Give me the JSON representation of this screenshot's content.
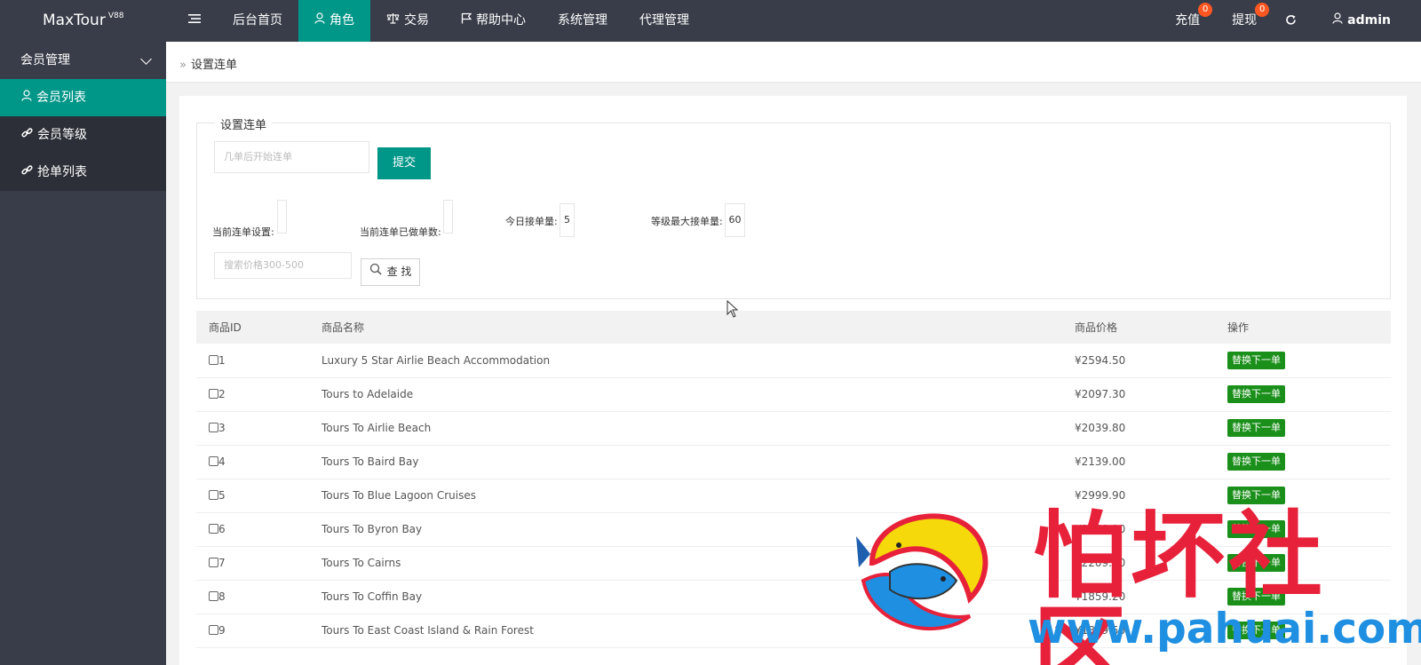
{
  "brand": {
    "name": "MaxTour",
    "version": "V88"
  },
  "topnav": {
    "items": [
      {
        "label": "后台首页",
        "icon": ""
      },
      {
        "label": "角色",
        "icon": "user-icon"
      },
      {
        "label": "交易",
        "icon": "balance-icon"
      },
      {
        "label": "帮助中心",
        "icon": "flag-icon"
      },
      {
        "label": "系统管理",
        "icon": ""
      },
      {
        "label": "代理管理",
        "icon": ""
      }
    ],
    "active_index": 1,
    "recharge": {
      "label": "充值",
      "badge": "0"
    },
    "withdraw": {
      "label": "提现",
      "badge": "0"
    },
    "user": "admin"
  },
  "sidebar": {
    "group": "会员管理",
    "items": [
      {
        "label": "会员列表",
        "icon": "user-icon"
      },
      {
        "label": "会员等级",
        "icon": "link-icon"
      },
      {
        "label": "抢单列表",
        "icon": "link-icon"
      }
    ],
    "active_index": 0
  },
  "breadcrumb": {
    "current": "设置连单"
  },
  "form": {
    "legend": "设置连单",
    "start_placeholder": "几单后开始连单",
    "submit_label": "提交",
    "current_setting_label": "当前连单设置:",
    "current_setting_value": "",
    "current_done_label": "当前连单已做单数:",
    "current_done_value": "",
    "today_label": "今日接单量:",
    "today_value": "5",
    "max_label": "等级最大接单量:",
    "max_value": "60",
    "search_placeholder": "搜索价格300-500",
    "search_label": "查 找"
  },
  "table": {
    "headers": [
      "商品ID",
      "商品名称",
      "商品价格",
      "操作"
    ],
    "action_label": "替换下一单",
    "rows": [
      {
        "id": "1",
        "name": "Luxury 5 Star Airlie Beach Accommodation",
        "price": "¥2594.50"
      },
      {
        "id": "2",
        "name": "Tours to Adelaide",
        "price": "¥2097.30"
      },
      {
        "id": "3",
        "name": "Tours To Airlie Beach",
        "price": "¥2039.80"
      },
      {
        "id": "4",
        "name": "Tours To Baird Bay",
        "price": "¥2139.00"
      },
      {
        "id": "5",
        "name": "Tours To Blue Lagoon Cruises",
        "price": "¥2999.90"
      },
      {
        "id": "6",
        "name": "Tours To Byron Bay",
        "price": "¥2789.90"
      },
      {
        "id": "7",
        "name": "Tours To Cairns",
        "price": "¥2209.50"
      },
      {
        "id": "8",
        "name": "Tours To Coffin Bay",
        "price": "¥1859.20"
      },
      {
        "id": "9",
        "name": "Tours To East Coast Island & Rain Forest",
        "price": "¥1899.50"
      }
    ]
  },
  "watermark": {
    "text": "怕坏社区",
    "url": "www.pahuai.com"
  },
  "colors": {
    "topbar": "#393d49",
    "accent": "#009688",
    "badge": "#ff5722",
    "action": "#1a8f1a",
    "watermark_red": "#e8213a",
    "watermark_blue": "#1e8fe1"
  }
}
